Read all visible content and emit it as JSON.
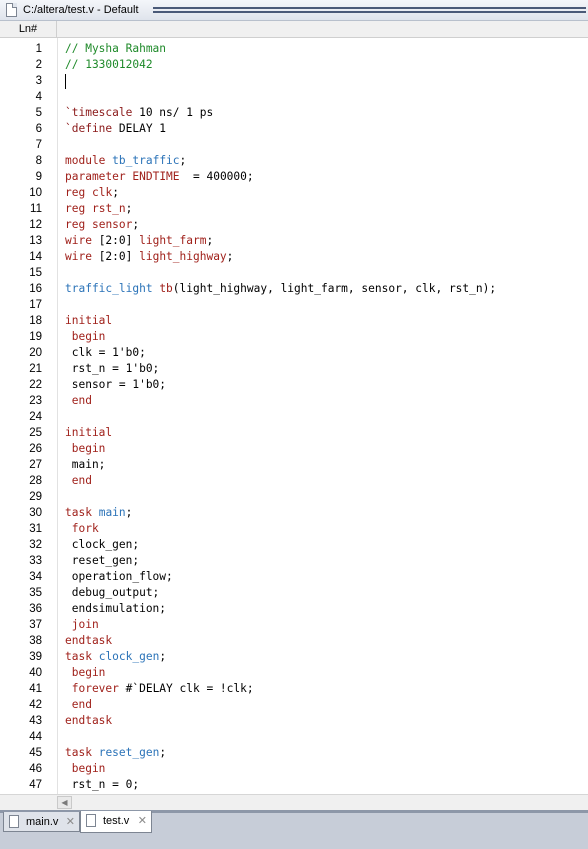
{
  "window": {
    "title": "C:/altera/test.v - Default",
    "icons": {
      "document": "document-icon"
    }
  },
  "editor": {
    "line_number_header": "Ln#",
    "colors": {
      "comment": "#1f8a2a",
      "keyword": "#a0211b",
      "identifier": "#2b73b8",
      "directive": "#8b1a1a",
      "text": "#000000"
    },
    "lines": [
      {
        "n": "1",
        "segs": [
          {
            "t": "// Mysha Rahman",
            "c": "comment"
          }
        ]
      },
      {
        "n": "2",
        "segs": [
          {
            "t": "// 1330012042",
            "c": "comment"
          }
        ]
      },
      {
        "n": "3",
        "segs": []
      },
      {
        "n": "4",
        "segs": []
      },
      {
        "n": "5",
        "segs": [
          {
            "t": "`timescale",
            "c": "dir"
          },
          {
            "t": " 10 ns/ 1 ps",
            "c": "plain"
          }
        ]
      },
      {
        "n": "6",
        "segs": [
          {
            "t": "`define",
            "c": "dir"
          },
          {
            "t": " DELAY 1",
            "c": "plain"
          }
        ]
      },
      {
        "n": "7",
        "segs": []
      },
      {
        "n": "8",
        "segs": [
          {
            "t": "module",
            "c": "kw"
          },
          {
            "t": " ",
            "c": "plain"
          },
          {
            "t": "tb_traffic",
            "c": "id"
          },
          {
            "t": ";",
            "c": "plain"
          }
        ]
      },
      {
        "n": "9",
        "segs": [
          {
            "t": "parameter",
            "c": "kw"
          },
          {
            "t": " ",
            "c": "plain"
          },
          {
            "t": "ENDTIME",
            "c": "kw"
          },
          {
            "t": "  = 400000;",
            "c": "plain"
          }
        ]
      },
      {
        "n": "10",
        "segs": [
          {
            "t": "reg",
            "c": "kw"
          },
          {
            "t": " ",
            "c": "plain"
          },
          {
            "t": "clk",
            "c": "kw"
          },
          {
            "t": ";",
            "c": "plain"
          }
        ]
      },
      {
        "n": "11",
        "segs": [
          {
            "t": "reg",
            "c": "kw"
          },
          {
            "t": " ",
            "c": "plain"
          },
          {
            "t": "rst_n",
            "c": "kw"
          },
          {
            "t": ";",
            "c": "plain"
          }
        ]
      },
      {
        "n": "12",
        "segs": [
          {
            "t": "reg",
            "c": "kw"
          },
          {
            "t": " ",
            "c": "plain"
          },
          {
            "t": "sensor",
            "c": "kw"
          },
          {
            "t": ";",
            "c": "plain"
          }
        ]
      },
      {
        "n": "13",
        "segs": [
          {
            "t": "wire",
            "c": "kw"
          },
          {
            "t": " [2:0] ",
            "c": "plain"
          },
          {
            "t": "light_farm",
            "c": "kw"
          },
          {
            "t": ";",
            "c": "plain"
          }
        ]
      },
      {
        "n": "14",
        "segs": [
          {
            "t": "wire",
            "c": "kw"
          },
          {
            "t": " [2:0] ",
            "c": "plain"
          },
          {
            "t": "light_highway",
            "c": "kw"
          },
          {
            "t": ";",
            "c": "plain"
          }
        ]
      },
      {
        "n": "15",
        "segs": []
      },
      {
        "n": "16",
        "segs": [
          {
            "t": "traffic_light",
            "c": "id"
          },
          {
            "t": " ",
            "c": "plain"
          },
          {
            "t": "tb",
            "c": "kw"
          },
          {
            "t": "(light_highway, light_farm, sensor, clk, rst_n);",
            "c": "plain"
          }
        ]
      },
      {
        "n": "17",
        "segs": []
      },
      {
        "n": "18",
        "segs": [
          {
            "t": "initial",
            "c": "kw"
          }
        ]
      },
      {
        "n": "19",
        "segs": [
          {
            "t": " begin",
            "c": "kw"
          }
        ]
      },
      {
        "n": "20",
        "segs": [
          {
            "t": " clk = 1'b0;",
            "c": "plain"
          }
        ]
      },
      {
        "n": "21",
        "segs": [
          {
            "t": " rst_n = 1'b0;",
            "c": "plain"
          }
        ]
      },
      {
        "n": "22",
        "segs": [
          {
            "t": " sensor = 1'b0;",
            "c": "plain"
          }
        ]
      },
      {
        "n": "23",
        "segs": [
          {
            "t": " end",
            "c": "kw"
          }
        ]
      },
      {
        "n": "24",
        "segs": []
      },
      {
        "n": "25",
        "segs": [
          {
            "t": "initial",
            "c": "kw"
          }
        ]
      },
      {
        "n": "26",
        "segs": [
          {
            "t": " begin",
            "c": "kw"
          }
        ]
      },
      {
        "n": "27",
        "segs": [
          {
            "t": " main;",
            "c": "plain"
          }
        ]
      },
      {
        "n": "28",
        "segs": [
          {
            "t": " end",
            "c": "kw"
          }
        ]
      },
      {
        "n": "29",
        "segs": []
      },
      {
        "n": "30",
        "segs": [
          {
            "t": "task",
            "c": "kw"
          },
          {
            "t": " ",
            "c": "plain"
          },
          {
            "t": "main",
            "c": "id"
          },
          {
            "t": ";",
            "c": "plain"
          }
        ]
      },
      {
        "n": "31",
        "segs": [
          {
            "t": " fork",
            "c": "kw"
          }
        ]
      },
      {
        "n": "32",
        "segs": [
          {
            "t": " clock_gen;",
            "c": "plain"
          }
        ]
      },
      {
        "n": "33",
        "segs": [
          {
            "t": " reset_gen;",
            "c": "plain"
          }
        ]
      },
      {
        "n": "34",
        "segs": [
          {
            "t": " operation_flow;",
            "c": "plain"
          }
        ]
      },
      {
        "n": "35",
        "segs": [
          {
            "t": " debug_output;",
            "c": "plain"
          }
        ]
      },
      {
        "n": "36",
        "segs": [
          {
            "t": " endsimulation;",
            "c": "plain"
          }
        ]
      },
      {
        "n": "37",
        "segs": [
          {
            "t": " join",
            "c": "kw"
          }
        ]
      },
      {
        "n": "38",
        "segs": [
          {
            "t": "endtask",
            "c": "kw"
          }
        ]
      },
      {
        "n": "39",
        "segs": [
          {
            "t": "task",
            "c": "kw"
          },
          {
            "t": " ",
            "c": "plain"
          },
          {
            "t": "clock_gen",
            "c": "id"
          },
          {
            "t": ";",
            "c": "plain"
          }
        ]
      },
      {
        "n": "40",
        "segs": [
          {
            "t": " begin",
            "c": "kw"
          }
        ]
      },
      {
        "n": "41",
        "segs": [
          {
            "t": " forever",
            "c": "kw"
          },
          {
            "t": " #`DELAY clk = !clk;",
            "c": "plain"
          }
        ]
      },
      {
        "n": "42",
        "segs": [
          {
            "t": " end",
            "c": "kw"
          }
        ]
      },
      {
        "n": "43",
        "segs": [
          {
            "t": "endtask",
            "c": "kw"
          }
        ]
      },
      {
        "n": "44",
        "segs": []
      },
      {
        "n": "45",
        "segs": [
          {
            "t": "task",
            "c": "kw"
          },
          {
            "t": " ",
            "c": "plain"
          },
          {
            "t": "reset_gen",
            "c": "id"
          },
          {
            "t": ";",
            "c": "plain"
          }
        ]
      },
      {
        "n": "46",
        "segs": [
          {
            "t": " begin",
            "c": "kw"
          }
        ]
      },
      {
        "n": "47",
        "segs": [
          {
            "t": " rst_n = 0;",
            "c": "plain"
          }
        ]
      }
    ]
  },
  "scrollbar": {
    "left_arrow": "◀",
    "icon": "scroll-left-arrow-icon"
  },
  "tabs": [
    {
      "label": "main.v",
      "close": "✕",
      "active": false
    },
    {
      "label": "test.v",
      "close": "✕",
      "active": true
    }
  ]
}
